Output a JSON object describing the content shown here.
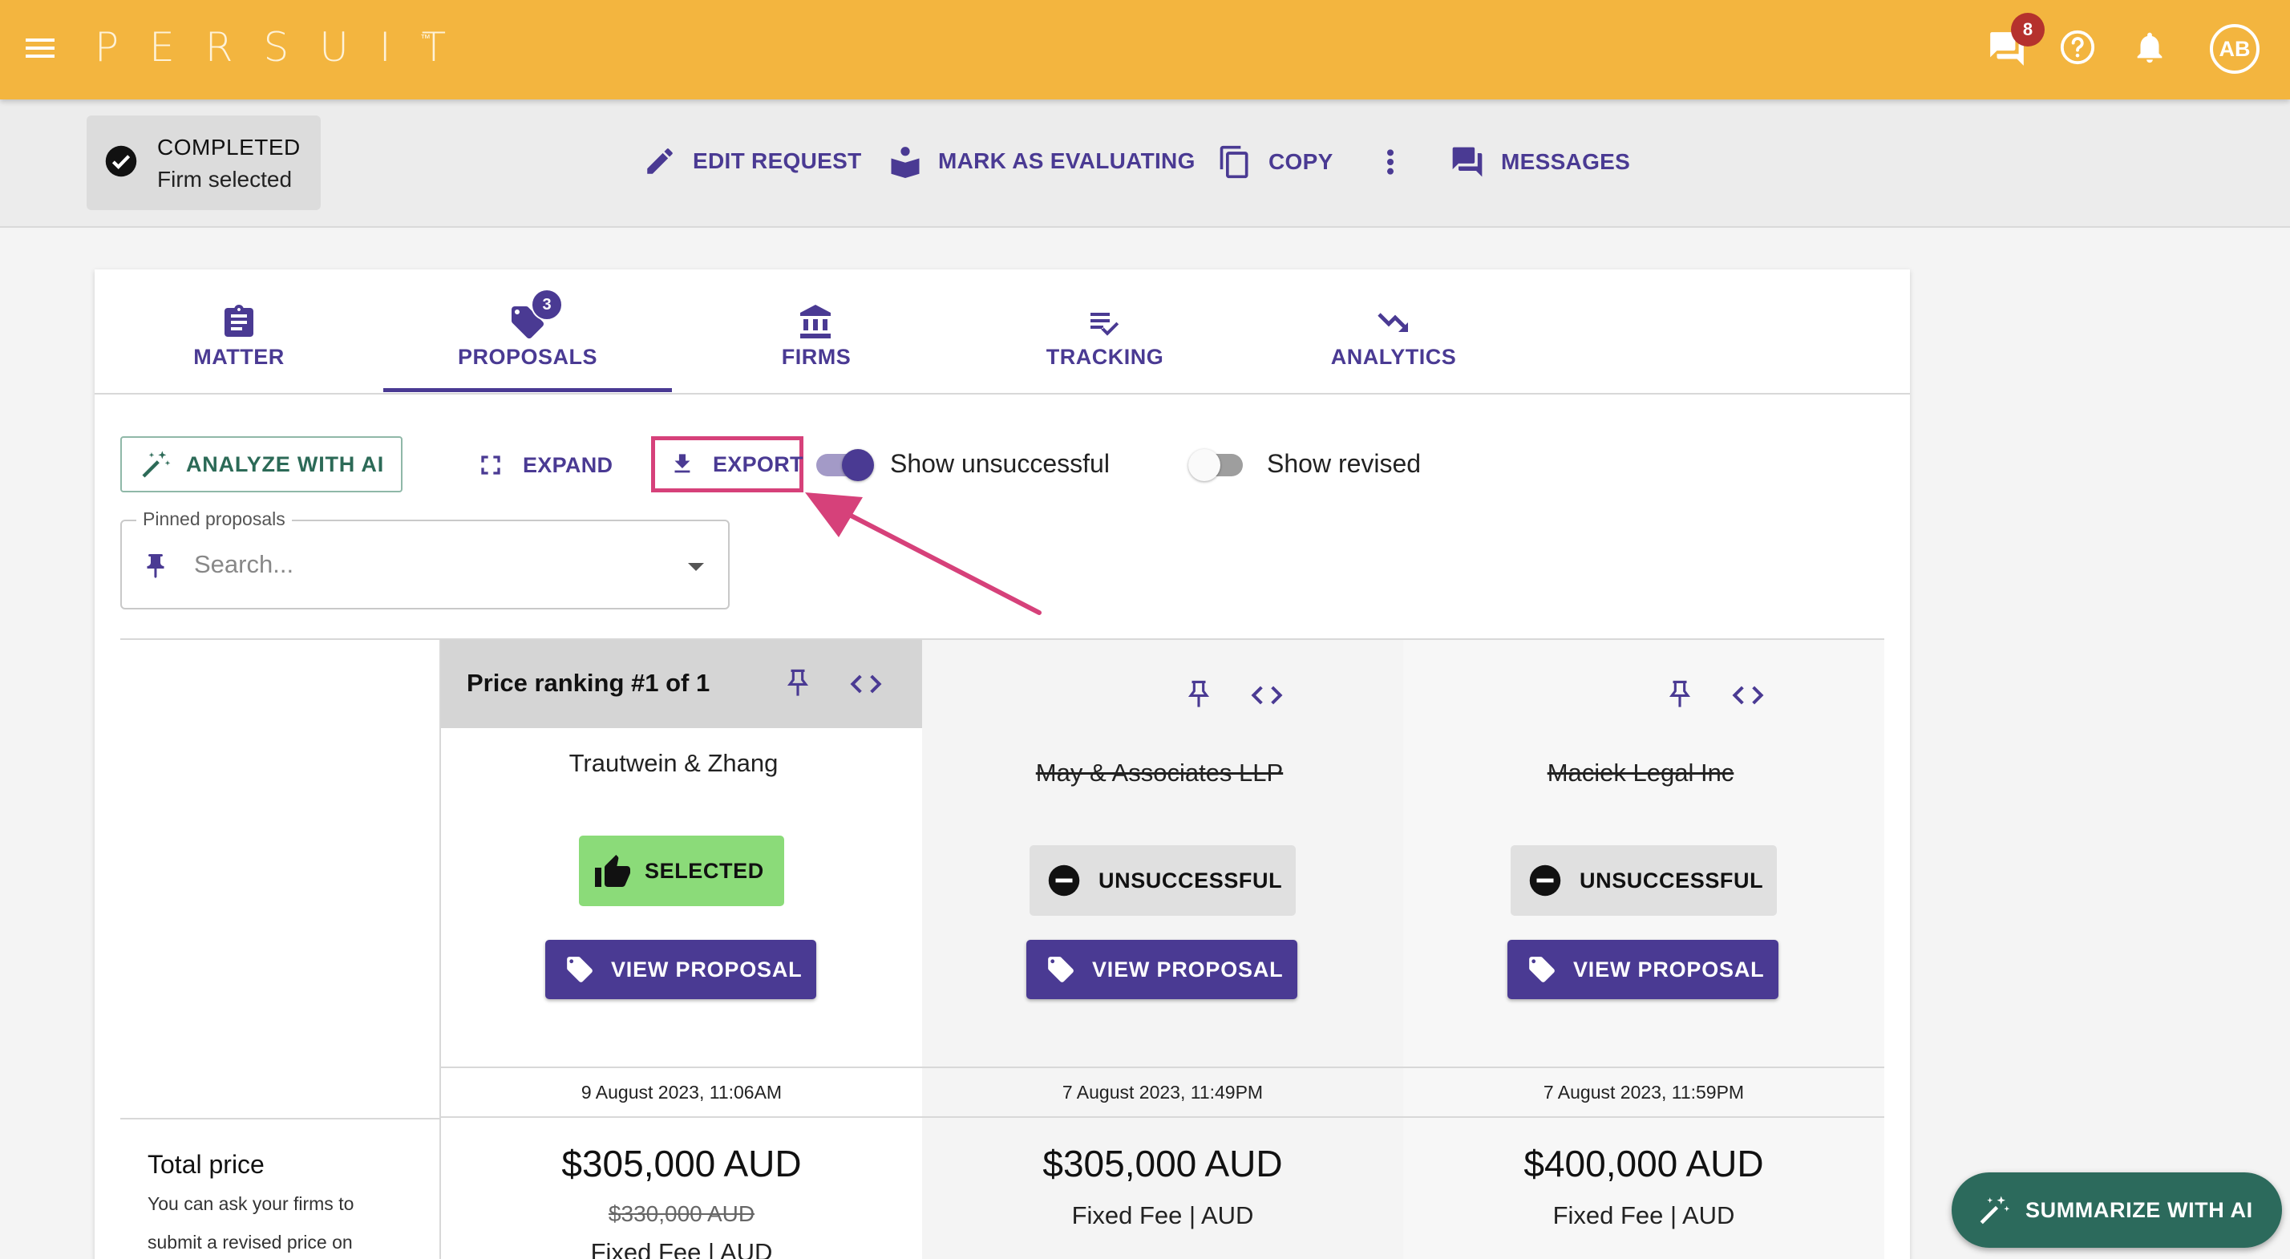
{
  "app": {
    "logo": "PERSUIT",
    "logo_tm": "™"
  },
  "topbar": {
    "chat_badge_count": "8",
    "avatar_initials": "AB",
    "icons": [
      "menu-icon",
      "chat-icon",
      "help-icon",
      "bell-icon"
    ]
  },
  "status": {
    "title": "COMPLETED",
    "subtitle": "Firm selected"
  },
  "actions": {
    "edit_request": "EDIT REQUEST",
    "mark_evaluating": "MARK AS EVALUATING",
    "copy": "COPY",
    "messages": "MESSAGES"
  },
  "tabs": [
    {
      "label": "MATTER",
      "icon": "clipboard-icon"
    },
    {
      "label": "PROPOSALS",
      "icon": "tag-icon",
      "badge": "3",
      "active": true
    },
    {
      "label": "FIRMS",
      "icon": "bank-icon"
    },
    {
      "label": "TRACKING",
      "icon": "checklist-icon"
    },
    {
      "label": "ANALYTICS",
      "icon": "trending-down-icon"
    }
  ],
  "controls": {
    "analyze": "ANALYZE WITH AI",
    "expand": "EXPAND",
    "export": "EXPORT",
    "show_unsuccessful": {
      "label": "Show unsuccessful",
      "on": true
    },
    "show_revised": {
      "label": "Show revised",
      "on": false
    }
  },
  "pinned": {
    "legend": "Pinned proposals",
    "placeholder": "Search..."
  },
  "proposals": [
    {
      "header": "Price ranking #1 of 1",
      "firm": "Trautwein & Zhang",
      "status": "SELECTED",
      "view": "VIEW PROPOSAL",
      "date": "9 August 2023, 11:06AM",
      "price": "$305,000 AUD",
      "old_price": "$330,000 AUD",
      "fee": "Fixed Fee | AUD"
    },
    {
      "firm": "May & Associates LLP",
      "status": "UNSUCCESSFUL",
      "view": "VIEW PROPOSAL",
      "date": "7 August 2023, 11:49PM",
      "price": "$305,000 AUD",
      "fee": "Fixed Fee | AUD"
    },
    {
      "firm": "Maciek Legal Inc",
      "status": "UNSUCCESSFUL",
      "view": "VIEW PROPOSAL",
      "date": "7 August 2023, 11:59PM",
      "price": "$400,000 AUD",
      "fee": "Fixed Fee | AUD"
    }
  ],
  "total": {
    "label": "Total price",
    "help_line1": "You can ask your firms to",
    "help_line2": "submit a revised price on"
  },
  "fab": {
    "label": "SUMMARIZE WITH AI"
  },
  "colors": {
    "topbar": "#f3b53f",
    "primary": "#4a3a93",
    "selected": "#8bdb79",
    "highlight": "#d6417a",
    "fab": "#2c6a5c"
  }
}
